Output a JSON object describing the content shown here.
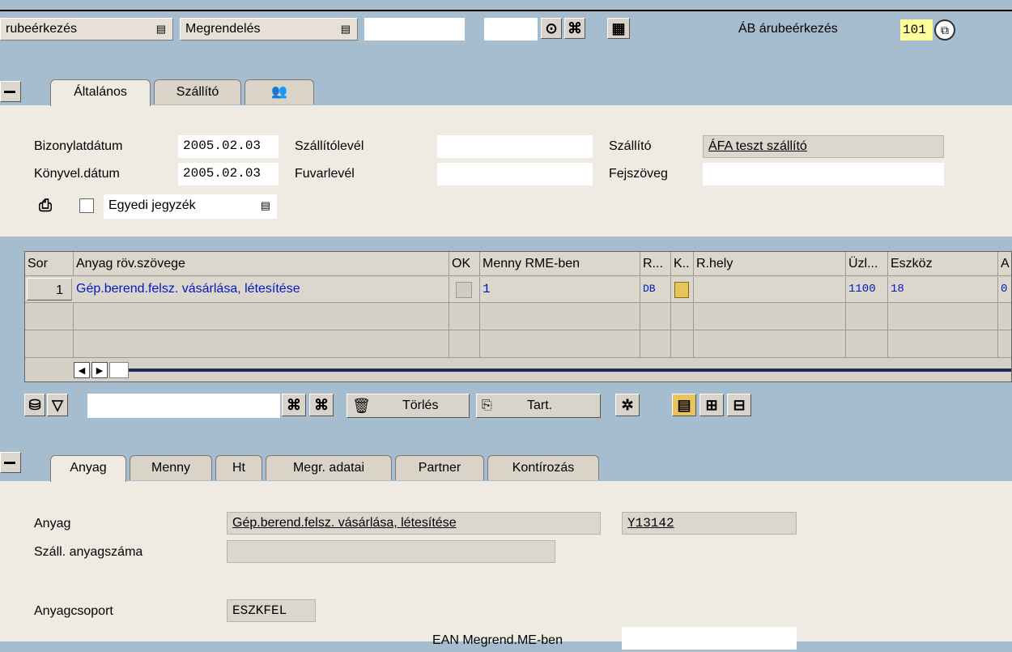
{
  "toolbar": {
    "action_select": "rubeérkezés",
    "reference_select": "Megrendelés",
    "reference_input": "",
    "reference_input2": "",
    "movement_label": "ÁB árubeérkezés",
    "movement_code": "101"
  },
  "header_tabs": [
    "Általános",
    "Szállító",
    ""
  ],
  "header": {
    "doc_date_label": "Bizonylatdátum",
    "doc_date": "2005.02.03",
    "post_date_label": "Könyvel.dátum",
    "post_date": "2005.02.03",
    "delivery_note_label": "Szállítólevél",
    "delivery_note": "",
    "bill_of_lading_label": "Fuvarlevél",
    "bill_of_lading": "",
    "vendor_label": "Szállító",
    "vendor": "ÁFA teszt szállító",
    "header_text_label": "Fejszöveg",
    "header_text": "",
    "slip_select": "Egyedi jegyzék"
  },
  "grid": {
    "columns": [
      "Sor",
      "Anyag röv.szövege",
      "OK",
      "Menny RME-ben",
      "R...",
      "K..",
      "R.hely",
      "Üzl...",
      "Eszköz",
      "A"
    ],
    "rows": [
      [
        "1",
        "Gép.berend.felsz. vásárlása, létesítése",
        "",
        "1",
        "DB",
        "",
        "",
        "1100",
        "18",
        "0"
      ]
    ]
  },
  "grid_toolbar": {
    "delete_label": "Törlés",
    "content_label": "Tart.",
    "search_input": ""
  },
  "detail_tabs": [
    "Anyag",
    "Menny",
    "Ht",
    "Megr. adatai",
    "Partner",
    "Kontírozás"
  ],
  "detail": {
    "material_label": "Anyag",
    "material_text": "Gép.berend.felsz. vásárlása, létesítése",
    "material_number": "Y13142",
    "vendor_mat_label": "Száll. anyagszáma",
    "vendor_mat": "",
    "mat_group_label": "Anyagcsoport",
    "mat_group": "ESZKFEL",
    "ean_label": "EAN Megrend.ME-ben",
    "ean": ""
  }
}
